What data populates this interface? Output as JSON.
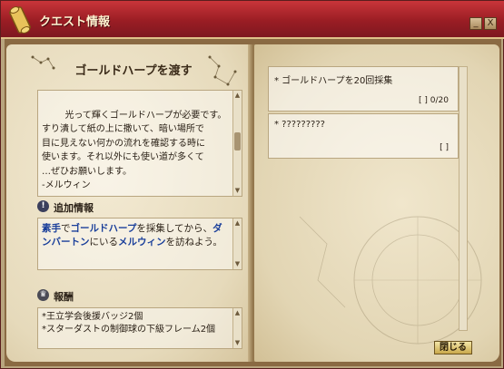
{
  "window": {
    "title": "クエスト情報",
    "minimize_label": "_",
    "close_label": "X"
  },
  "left_page": {
    "quest_title": "ゴールドハープを渡す",
    "description": "光って輝くゴールドハープが必要です。\nすり潰して紙の上に撒いて、暗い場所で\n目に見えない何かの流れを確認する時に\n使います。それ以外にも使い道が多くて\n…ぜひお願いします。\n-メルウィン",
    "info_heading": "追加情報",
    "info_segments": [
      {
        "text": "素手",
        "hl": true
      },
      {
        "text": "で",
        "hl": false
      },
      {
        "text": "ゴールドハープ",
        "hl": true
      },
      {
        "text": "を採集してから、",
        "hl": false
      },
      {
        "text": "ダンバートン",
        "hl": true
      },
      {
        "text": "にいる",
        "hl": false
      },
      {
        "text": "メルウィン",
        "hl": true
      },
      {
        "text": "を訪ねよう。",
        "hl": false
      }
    ],
    "reward_heading": "報酬",
    "rewards": [
      "*王立学会後援バッジ2個",
      "*スターダストの制御球の下級フレーム2個"
    ]
  },
  "right_page": {
    "objectives": [
      {
        "title": "* ゴールドハープを20回採集",
        "count": "[ ] 0/20"
      },
      {
        "title": "* ?????????",
        "count": "[ ]"
      }
    ]
  },
  "footer": {
    "close_button": "閉じる"
  },
  "colors": {
    "titlebar": "#9a1d24",
    "highlight_text": "#1a3f9a",
    "page": "#f0e6cc"
  }
}
